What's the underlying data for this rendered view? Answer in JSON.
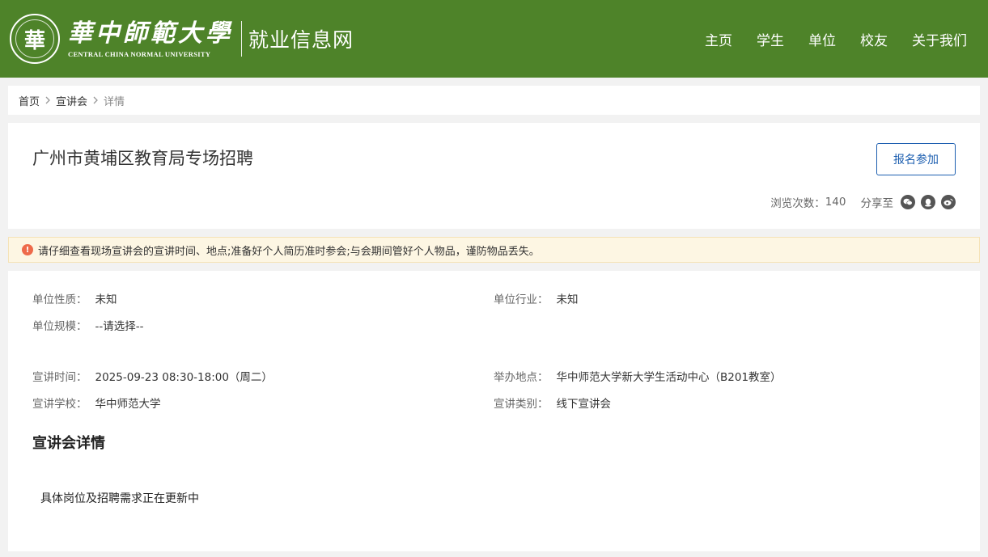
{
  "header": {
    "logo_cn": "華中師範大學",
    "logo_en": "CENTRAL CHINA NORMAL UNIVERSITY",
    "seal_glyph": "華",
    "site_name": "就业信息网",
    "nav": [
      {
        "label": "主页"
      },
      {
        "label": "学生"
      },
      {
        "label": "单位"
      },
      {
        "label": "校友"
      },
      {
        "label": "关于我们"
      }
    ],
    "color": "#4e8329"
  },
  "breadcrumb": {
    "home": "首页",
    "section": "宣讲会",
    "current": "详情"
  },
  "event": {
    "title": "广州市黄埔区教育局专场招聘",
    "signup_label": "报名参加",
    "views_label": "浏览次数：",
    "views": "140",
    "share_label": "分享至",
    "share_icons": [
      "wechat-icon",
      "qq-icon",
      "weibo-icon"
    ]
  },
  "notice": {
    "icon": "!",
    "text": "请仔细查看现场宣讲会的宣讲时间、地点;准备好个人简历准时参会;与会期间管好个人物品，谨防物品丢失。"
  },
  "details": {
    "nature_label": "单位性质：",
    "nature": "未知",
    "industry_label": "单位行业：",
    "industry": "未知",
    "scale_label": "单位规模：",
    "scale": "--请选择--",
    "time_label": "宣讲时间：",
    "time": "2025-09-23 08:30-18:00（周二）",
    "place_label": "举办地点：",
    "place": "华中师范大学新大学生活动中心（B201教室）",
    "school_label": "宣讲学校：",
    "school": "华中师范大学",
    "type_label": "宣讲类别：",
    "type": "线下宣讲会",
    "section_title": "宣讲会详情",
    "section_body": "具体岗位及招聘需求正在更新中"
  }
}
